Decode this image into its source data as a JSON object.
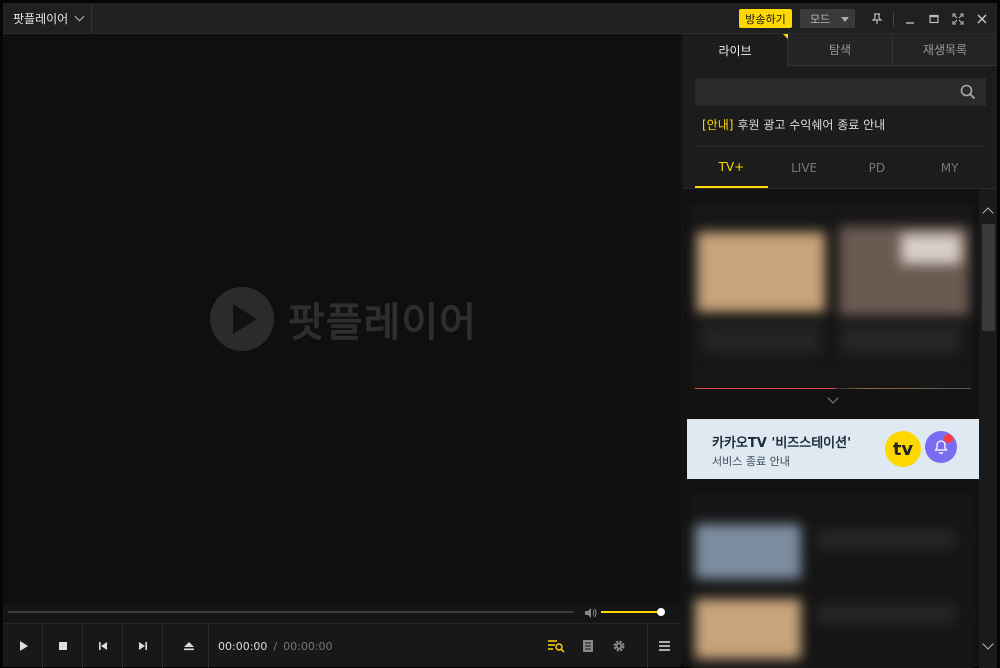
{
  "titlebar": {
    "app_menu_label": "팟플레이어",
    "broadcast_label": "방송하기",
    "mode_label": "모드"
  },
  "video": {
    "watermark_text": "팟플레이어"
  },
  "playback": {
    "current_time": "00:00:00",
    "separator": "/",
    "duration": "00:00:00",
    "volume_level": 0.95
  },
  "panel": {
    "tabs": [
      {
        "label": "라이브"
      },
      {
        "label": "탐색"
      },
      {
        "label": "재생목록"
      }
    ],
    "notice": {
      "tag": "[안내]",
      "text": "후원 광고 수익쉐어 종료 안내"
    },
    "subtabs": [
      {
        "label": "TV+"
      },
      {
        "label": "LIVE"
      },
      {
        "label": "PD"
      },
      {
        "label": "MY"
      }
    ],
    "banner": {
      "title": "카카오TV '비즈스테이션'",
      "subtitle": "서비스 종료 안내",
      "logo_text": "tv"
    }
  },
  "colors": {
    "accent": "#ffd800",
    "banner_bg": "#dfe9f1",
    "bell": "#7a6cf0"
  }
}
